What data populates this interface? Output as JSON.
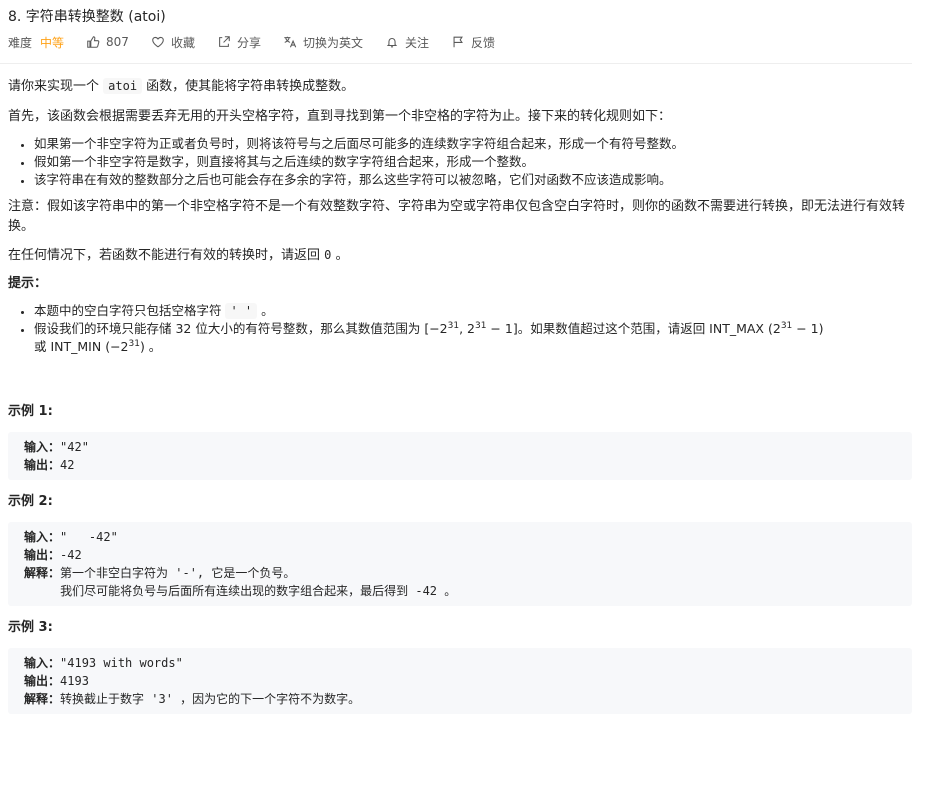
{
  "problem": {
    "title": "8. 字符串转换整数 (atoi)",
    "difficulty_label": "难度",
    "difficulty_value": "中等",
    "likes": "807",
    "favorite": "收藏",
    "share": "分享",
    "switch_language": "切换为英文",
    "follow": "关注",
    "feedback": "反馈"
  },
  "colors": {
    "accent": "#ffa116",
    "code_bg": "#f7f8fa"
  },
  "description": {
    "p1_before": "请你来实现一个 ",
    "p1_code": "atoi",
    "p1_after": " 函数，使其能将字符串转换成整数。",
    "p2": "首先，该函数会根据需要丢弃无用的开头空格字符，直到寻找到第一个非空格的字符为止。接下来的转化规则如下：",
    "rules": [
      "如果第一个非空字符为正或者负号时，则将该符号与之后面尽可能多的连续数字字符组合起来，形成一个有符号整数。",
      "假如第一个非空字符是数字，则直接将其与之后连续的数字字符组合起来，形成一个整数。",
      "该字符串在有效的整数部分之后也可能会存在多余的字符，那么这些字符可以被忽略，它们对函数不应该造成影响。"
    ],
    "note": "注意：假如该字符串中的第一个非空格字符不是一个有效整数字符、字符串为空或字符串仅包含空白字符时，则你的函数不需要进行转换，即无法进行有效转换。",
    "p_zero_before": "在任何情况下，若函数不能进行有效的转换时，请返回 ",
    "p_zero_code": "0",
    "p_zero_after": " 。",
    "hint_title": "提示：",
    "hint1_before": "本题中的空白字符只包括空格字符 ",
    "hint1_code": "' '",
    "hint1_after": " 。",
    "hint2_a": "假设我们的环境只能存储 32 位大小的有符号整数，那么其数值范围为 [−2",
    "hint2_exp1": "31",
    "hint2_b": ",  2",
    "hint2_exp2": "31",
    "hint2_c": " − 1]。如果数值超过这个范围，请返回  INT_MAX (2",
    "hint2_exp3": "31",
    "hint2_d": " − 1)",
    "hint2_e": "或 INT_MIN (−2",
    "hint2_exp4": "31",
    "hint2_f": ") 。"
  },
  "examples": [
    {
      "title": "示例 1:",
      "input_label": "输入：",
      "input": "\"42\"",
      "output_label": "输出：",
      "output": "42"
    },
    {
      "title": "示例 2:",
      "input_label": "输入：",
      "input": "\"   -42\"",
      "output_label": "输出：",
      "output": "-42",
      "explain_label": "解释：",
      "explain1": "第一个非空白字符为 '-', 它是一个负号。",
      "explain2": "     我们尽可能将负号与后面所有连续出现的数字组合起来，最后得到 -42 。"
    },
    {
      "title": "示例 3:",
      "input_label": "输入：",
      "input": "\"4193 with words\"",
      "output_label": "输出：",
      "output": "4193",
      "explain_label": "解释：",
      "explain1": "转换截止于数字 '3' ，因为它的下一个字符不为数字。"
    }
  ]
}
